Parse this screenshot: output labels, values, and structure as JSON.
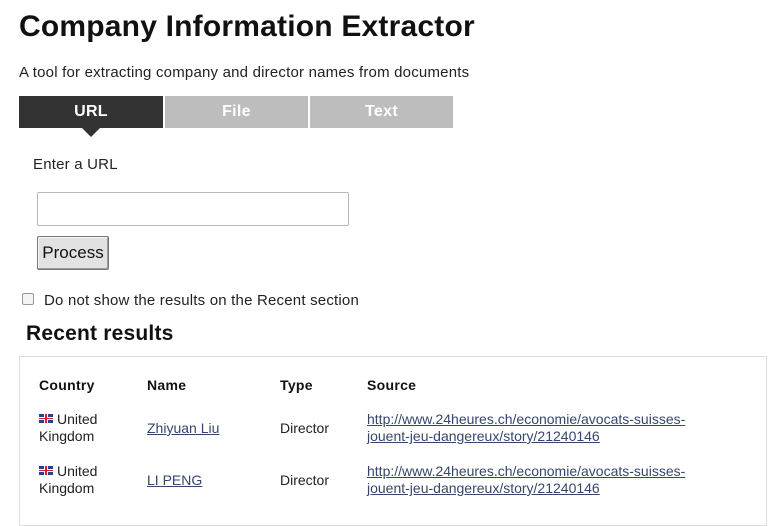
{
  "header": {
    "title": "Company Information Extractor",
    "subtitle": "A tool for extracting company and director names from documents"
  },
  "tabs": [
    {
      "label": "URL",
      "active": true
    },
    {
      "label": "File",
      "active": false
    },
    {
      "label": "Text",
      "active": false
    }
  ],
  "form": {
    "url_label": "Enter a URL",
    "url_value": "",
    "url_placeholder": "",
    "process_label": "Process",
    "hide_checkbox_label": "Do not show the results on the Recent section",
    "hide_checkbox_checked": false
  },
  "recent": {
    "title": "Recent results",
    "columns": {
      "country": "Country",
      "name": "Name",
      "type": "Type",
      "source": "Source"
    },
    "rows": [
      {
        "flag_icon": "uk-flag-icon",
        "country_line1": "United",
        "country_line2": "Kingdom",
        "name": "Zhiyuan Liu",
        "type": "Director",
        "source_line1": "http://www.24heures.ch/economie/avocats-suisses-",
        "source_line2": "jouent-jeu-dangereux/story/21240146"
      },
      {
        "flag_icon": "uk-flag-icon",
        "country_line1": "United",
        "country_line2": "Kingdom",
        "name": "LI PENG",
        "type": "Director",
        "source_line1": "http://www.24heures.ch/economie/avocats-suisses-",
        "source_line2": "jouent-jeu-dangereux/story/21240146"
      }
    ]
  },
  "colors": {
    "active_tab": "#333333",
    "inactive_tab": "#bdbdbd",
    "link": "#36466b"
  }
}
